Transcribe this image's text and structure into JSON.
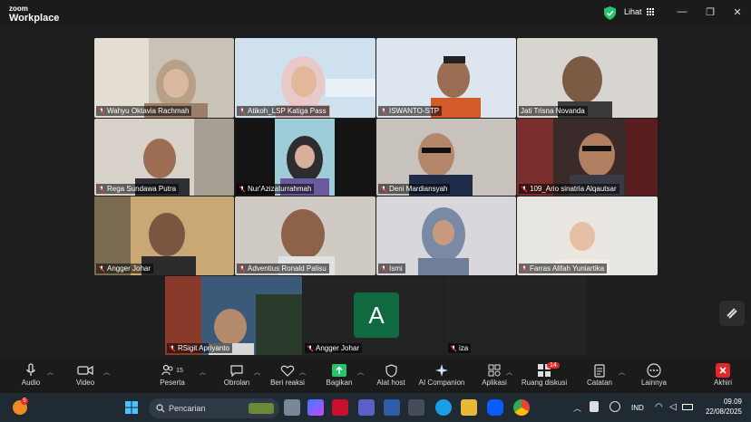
{
  "app": {
    "logo_top": "zoom",
    "logo_bottom": "Workplace",
    "view_label": "Lihat"
  },
  "participants": [
    {
      "name": "Wahyu Oktavia Rachmah"
    },
    {
      "name": "Atikoh_LSP Katiga Pass"
    },
    {
      "name": "ISWANTO-STP"
    },
    {
      "name": "Jati Trisna Novanda"
    },
    {
      "name": "Rega Sundawa Putra"
    },
    {
      "name": "Nur'Azizaturrahmah"
    },
    {
      "name": "Deni Mardiansyah"
    },
    {
      "name": "109_Ario sinatria Alqautsar"
    },
    {
      "name": "Angger Johar"
    },
    {
      "name": "Adventius Ronald Palisu"
    },
    {
      "name": "Ismi"
    },
    {
      "name": "Farras Alifah Yuniartika"
    },
    {
      "name": "RSigit Apriyanto"
    },
    {
      "name": "Angger Johar",
      "avatar_letter": "A"
    },
    {
      "name": "iza"
    }
  ],
  "toolbar": {
    "audio": "Audio",
    "video": "Video",
    "participants": "Peserta",
    "participants_count": "15",
    "chat": "Obrolan",
    "reactions": "Beri reaksi",
    "share": "Bagikan",
    "host_tools": "Alat host",
    "ai": "AI Companion",
    "apps": "Aplikasi",
    "breakout": "Ruang diskusi",
    "breakout_badge": "14",
    "notes": "Catatan",
    "more": "Lainnya",
    "end": "Akhiri"
  },
  "taskbar": {
    "search_placeholder": "Pencarian",
    "weather_badge": "5",
    "lang": "IND",
    "time": "09.09",
    "date": "22/08/2025"
  },
  "colors": {
    "accent": "#27c46a",
    "end": "#e02828",
    "avatar": "#0f6b3f"
  }
}
